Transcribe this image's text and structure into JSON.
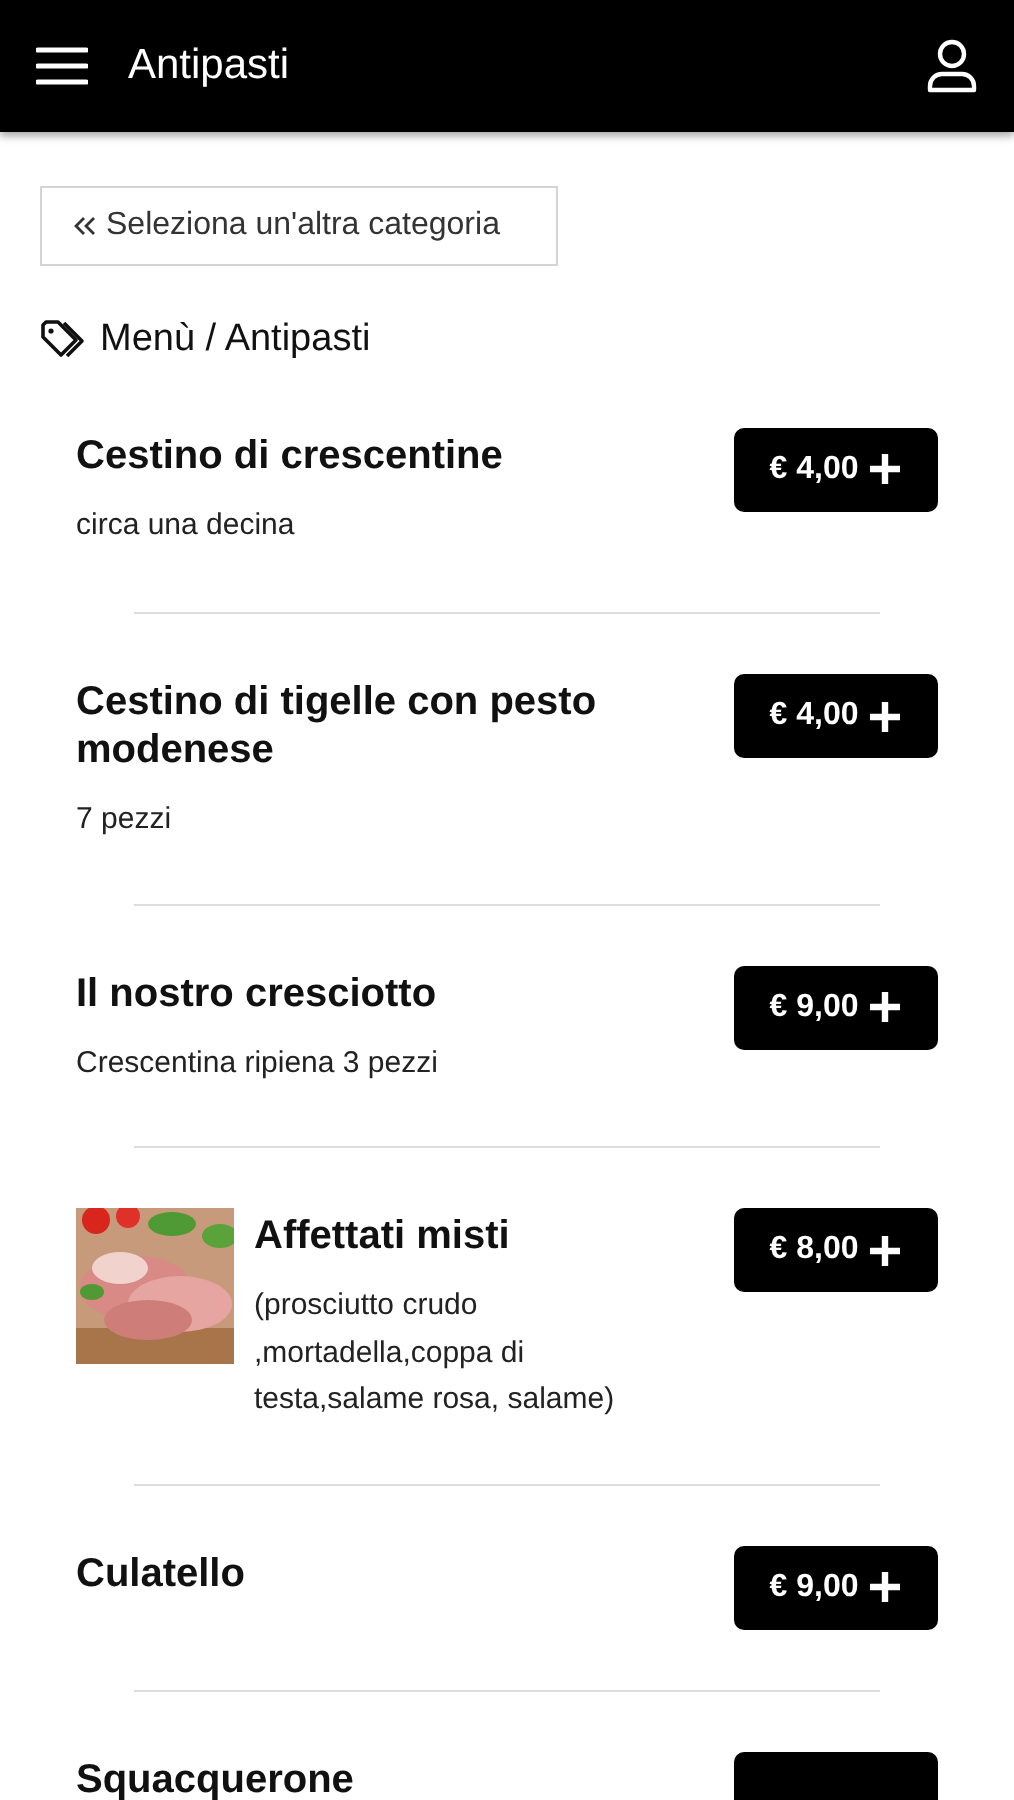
{
  "header": {
    "title": "Antipasti"
  },
  "back_button": {
    "label": "Seleziona un'altra categoria"
  },
  "breadcrumb": "Menù / Antipasti",
  "items": [
    {
      "name": "Cestino di crescentine",
      "description": "circa una decina",
      "price": "€ 4,00"
    },
    {
      "name": "Cestino di tigelle con pesto modenese",
      "description": "7 pezzi",
      "price": "€ 4,00"
    },
    {
      "name": "Il nostro cresciotto",
      "description": "Crescentina ripiena 3 pezzi",
      "price": "€ 9,00"
    },
    {
      "name": "Affettati misti",
      "description": "(prosciutto crudo ,mortadella,coppa di testa,salame rosa, salame)",
      "price": "€ 8,00"
    },
    {
      "name": "Culatello",
      "price": "€ 9,00"
    },
    {
      "name": "Squacquerone"
    }
  ]
}
